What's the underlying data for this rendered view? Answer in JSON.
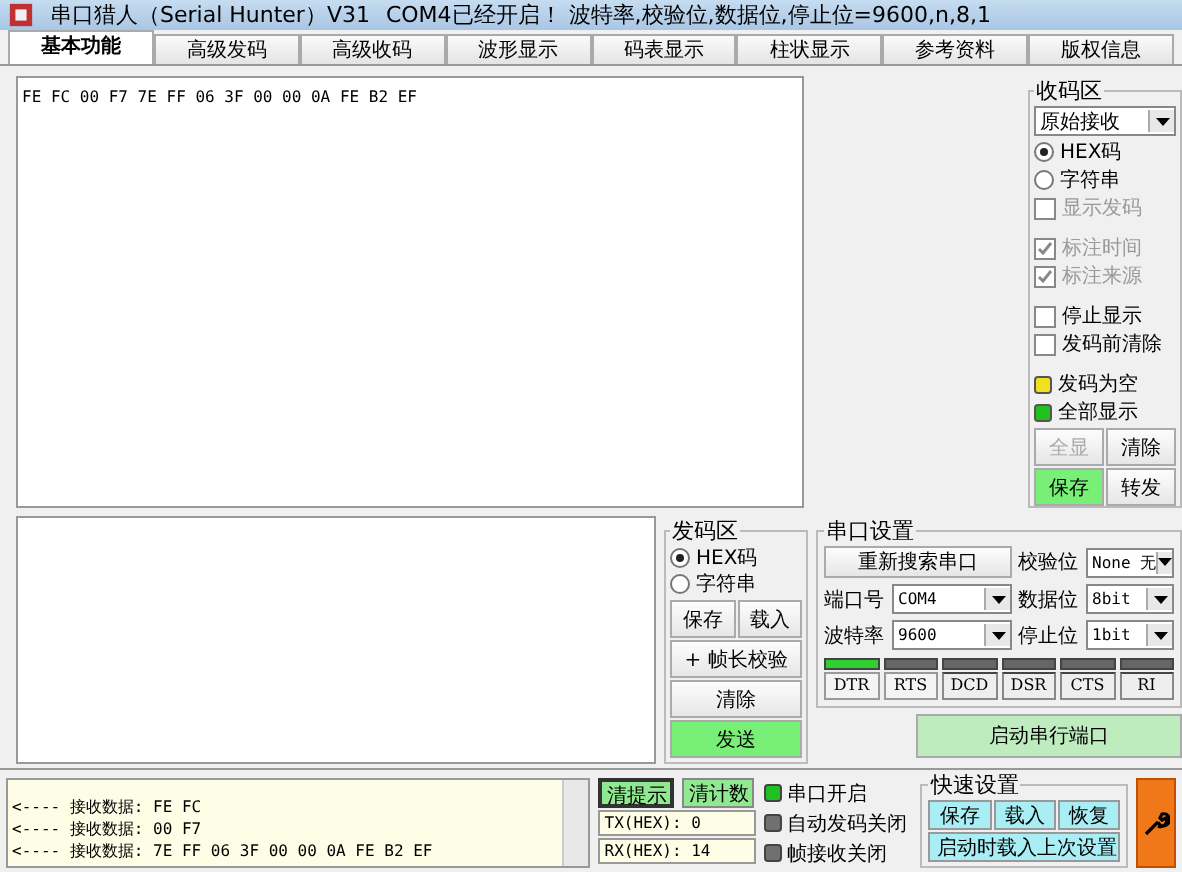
{
  "window": {
    "title": "串口猎人（Serial Hunter）V31",
    "status": "COM4已经开启！ 波特率,校验位,数据位,停止位=9600,n,8,1"
  },
  "tabs": [
    {
      "label": "基本功能",
      "selected": true
    },
    {
      "label": "高级发码",
      "selected": false
    },
    {
      "label": "高级收码",
      "selected": false
    },
    {
      "label": "波形显示",
      "selected": false
    },
    {
      "label": "码表显示",
      "selected": false
    },
    {
      "label": "柱状显示",
      "selected": false
    },
    {
      "label": "参考资料",
      "selected": false
    },
    {
      "label": "版权信息",
      "selected": false
    }
  ],
  "receive_text": "FE FC 00 F7 7E FF 06 3F 00 00 0A FE B2 EF",
  "receive_panel": {
    "title": "收码区",
    "mode": "原始接收",
    "radios": [
      {
        "label": "HEX码",
        "selected": true
      },
      {
        "label": "字符串",
        "selected": false
      }
    ],
    "checks": [
      {
        "label": "显示发码",
        "checked": false,
        "disabled": true
      },
      {
        "label": "标注时间",
        "checked": true,
        "disabled": true
      },
      {
        "label": "标注来源",
        "checked": true,
        "disabled": true
      },
      {
        "label": "停止显示",
        "checked": false,
        "disabled": false
      },
      {
        "label": "发码前清除",
        "checked": false,
        "disabled": false
      }
    ],
    "indicators": [
      {
        "label": "发码为空",
        "color": "#f0e020"
      },
      {
        "label": "全部显示",
        "color": "#20c020"
      }
    ],
    "buttons": [
      {
        "label": "全显",
        "disabled": true,
        "highlighted": false
      },
      {
        "label": "清除",
        "disabled": false,
        "highlighted": false
      },
      {
        "label": "保存",
        "disabled": false,
        "highlighted": true
      },
      {
        "label": "转发",
        "disabled": false,
        "highlighted": false
      }
    ]
  },
  "send_panel": {
    "title": "发码区",
    "radios": [
      {
        "label": "HEX码",
        "selected": true
      },
      {
        "label": "字符串",
        "selected": false
      }
    ],
    "buttons": [
      {
        "label": "保存",
        "highlighted": false
      },
      {
        "label": "载入",
        "highlighted": false
      },
      {
        "label": "+ 帧长校验",
        "highlighted": false
      },
      {
        "label": "清除",
        "highlighted": false
      },
      {
        "label": "发送",
        "highlighted": true
      }
    ]
  },
  "port_settings": {
    "title": "串口设置",
    "rescan": "重新搜索串口",
    "fields": [
      {
        "label": "校验位",
        "value": "None 无"
      },
      {
        "label": "端口号",
        "value": "COM4"
      },
      {
        "label": "数据位",
        "value": "8bit"
      },
      {
        "label": "波特率",
        "value": "9600"
      },
      {
        "label": "停止位",
        "value": "1bit"
      }
    ],
    "signals": [
      {
        "label": "DTR",
        "on": true,
        "kind": "button"
      },
      {
        "label": "RTS",
        "on": false,
        "kind": "button"
      },
      {
        "label": "DCD",
        "on": false,
        "kind": "indicator"
      },
      {
        "label": "DSR",
        "on": false,
        "kind": "indicator"
      },
      {
        "label": "CTS",
        "on": false,
        "kind": "indicator"
      },
      {
        "label": "RI",
        "on": false,
        "kind": "indicator"
      }
    ],
    "start": "启动串行端口"
  },
  "log": {
    "lines": [
      "<---- 接收数据: FE FC",
      "<---- 接收数据: 00 F7",
      "<---- 接收数据: 7E FF 06 3F 00 00 0A FE B2 EF"
    ],
    "buttons": [
      {
        "label": "清提示",
        "selected": true
      },
      {
        "label": "清计数",
        "selected": false
      }
    ],
    "counters": [
      "TX(HEX): 0",
      "RX(HEX): 14"
    ],
    "statuses": [
      {
        "label": "串口开启",
        "color": "#20c020"
      },
      {
        "label": "自动发码关闭",
        "color": "#707070"
      },
      {
        "label": "帧接收关闭",
        "color": "#707070"
      }
    ],
    "quick": {
      "title": "快速设置",
      "buttons": [
        "保存",
        "载入",
        "恢复",
        "启动时载入上次设置"
      ]
    }
  }
}
